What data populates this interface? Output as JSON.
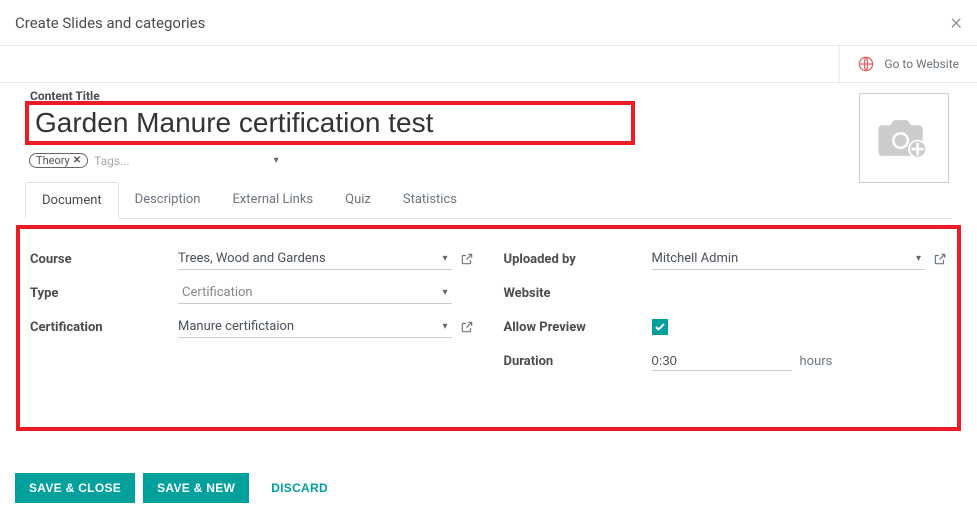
{
  "modal": {
    "title": "Create Slides and categories"
  },
  "header": {
    "goto_website": "Go to Website"
  },
  "form": {
    "content_title_label": "Content Title",
    "content_title": "Garden Manure certification test",
    "tag": "Theory",
    "tag_placeholder": "Tags..."
  },
  "tabs": [
    {
      "label": "Document"
    },
    {
      "label": "Description"
    },
    {
      "label": "External Links"
    },
    {
      "label": "Quiz"
    },
    {
      "label": "Statistics"
    }
  ],
  "fields": {
    "course_label": "Course",
    "course_value": "Trees, Wood and Gardens",
    "type_label": "Type",
    "type_value": "Certification",
    "certification_label": "Certification",
    "certification_value": "Manure certifictaion",
    "uploaded_by_label": "Uploaded by",
    "uploaded_by_value": "Mitchell Admin",
    "website_label": "Website",
    "allow_preview_label": "Allow Preview",
    "duration_label": "Duration",
    "duration_value": "0:30",
    "duration_unit": "hours"
  },
  "footer": {
    "save_close": "SAVE & CLOSE",
    "save_new": "SAVE & NEW",
    "discard": "DISCARD"
  }
}
